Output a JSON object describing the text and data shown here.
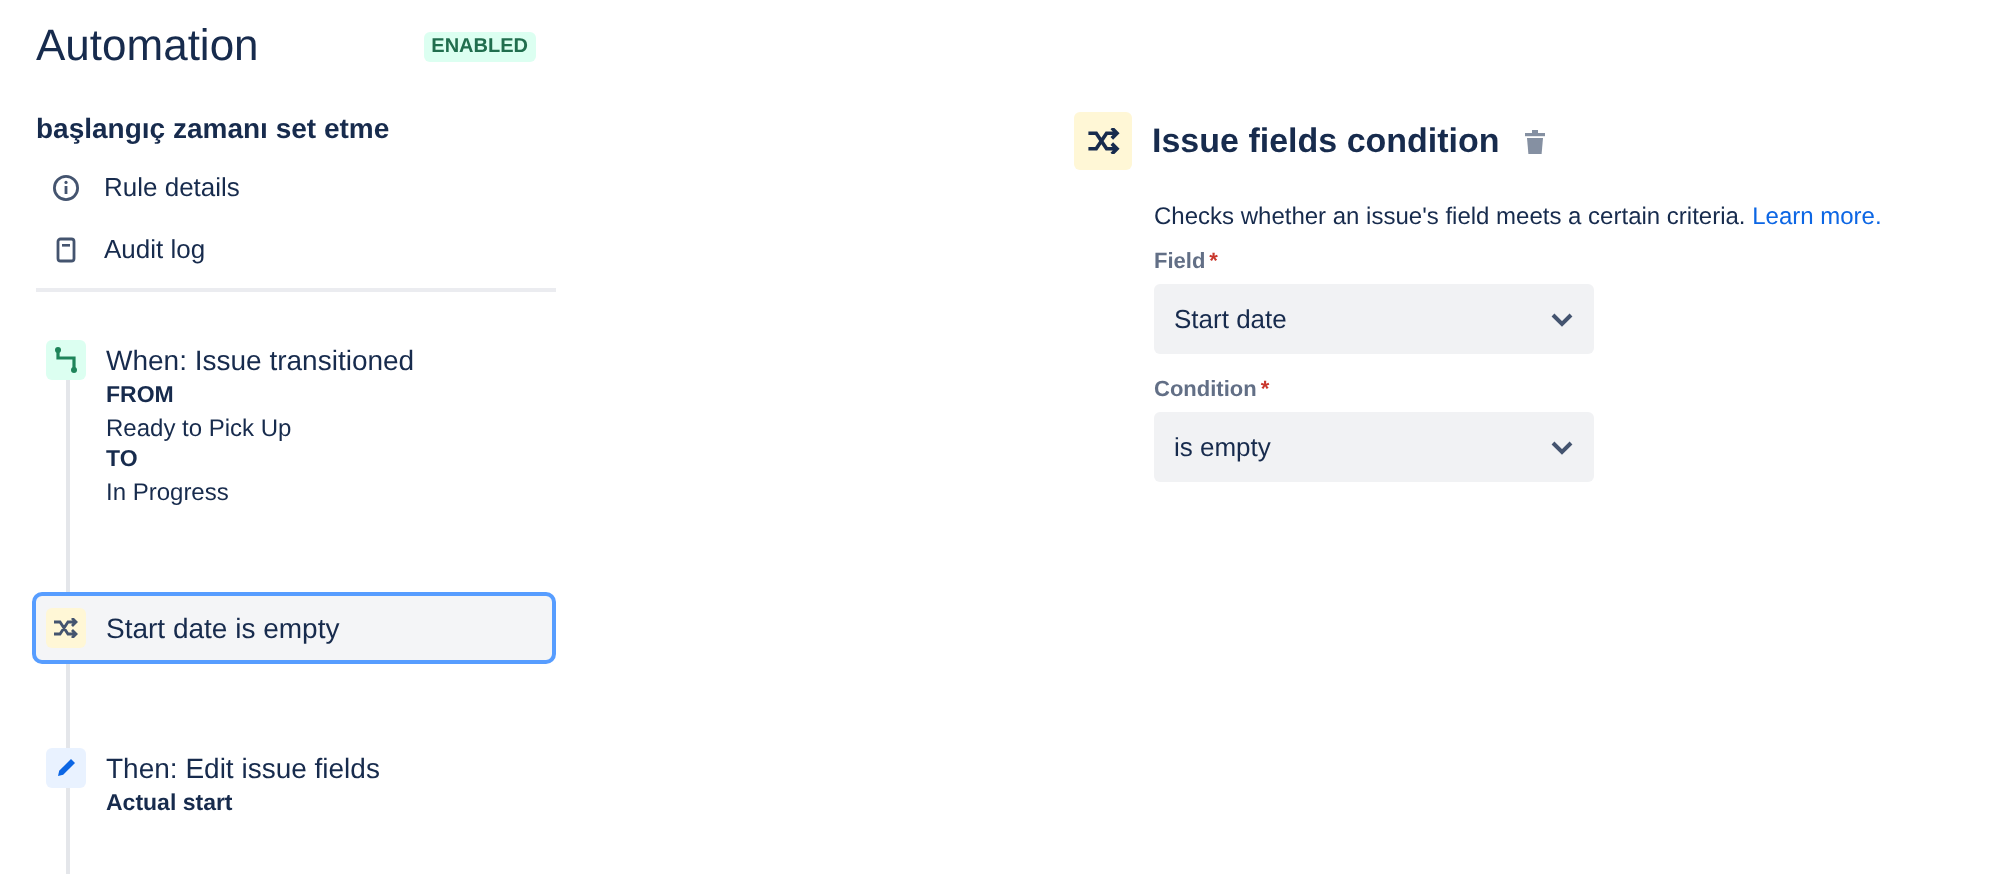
{
  "header": {
    "title": "Automation",
    "status_badge": "ENABLED"
  },
  "rule": {
    "name": "başlangıç zamanı set etme",
    "links": [
      {
        "kind": "info",
        "label": "Rule details"
      },
      {
        "kind": "log",
        "label": "Audit log"
      }
    ]
  },
  "steps": [
    {
      "kind": "trigger",
      "title": "When: Issue transitioned",
      "selected": false,
      "details": [
        {
          "text": "FROM",
          "bold": true
        },
        {
          "text": "Ready to Pick Up",
          "bold": false
        },
        {
          "text": "TO",
          "bold": true
        },
        {
          "text": "In Progress",
          "bold": false
        }
      ]
    },
    {
      "kind": "condition",
      "title": "Start date is empty",
      "selected": true
    },
    {
      "kind": "action",
      "title": "Then: Edit issue fields",
      "selected": false,
      "details": [
        {
          "text": "Actual start",
          "bold": true
        }
      ]
    }
  ],
  "panel": {
    "title": "Issue fields condition",
    "description": "Checks whether an issue's field meets a certain criteria.",
    "link": "Learn more.",
    "fields": [
      {
        "label": "Field",
        "required_mark": "*",
        "value": "Start date"
      },
      {
        "label": "Condition",
        "required_mark": "*",
        "value": "is empty"
      }
    ]
  }
}
